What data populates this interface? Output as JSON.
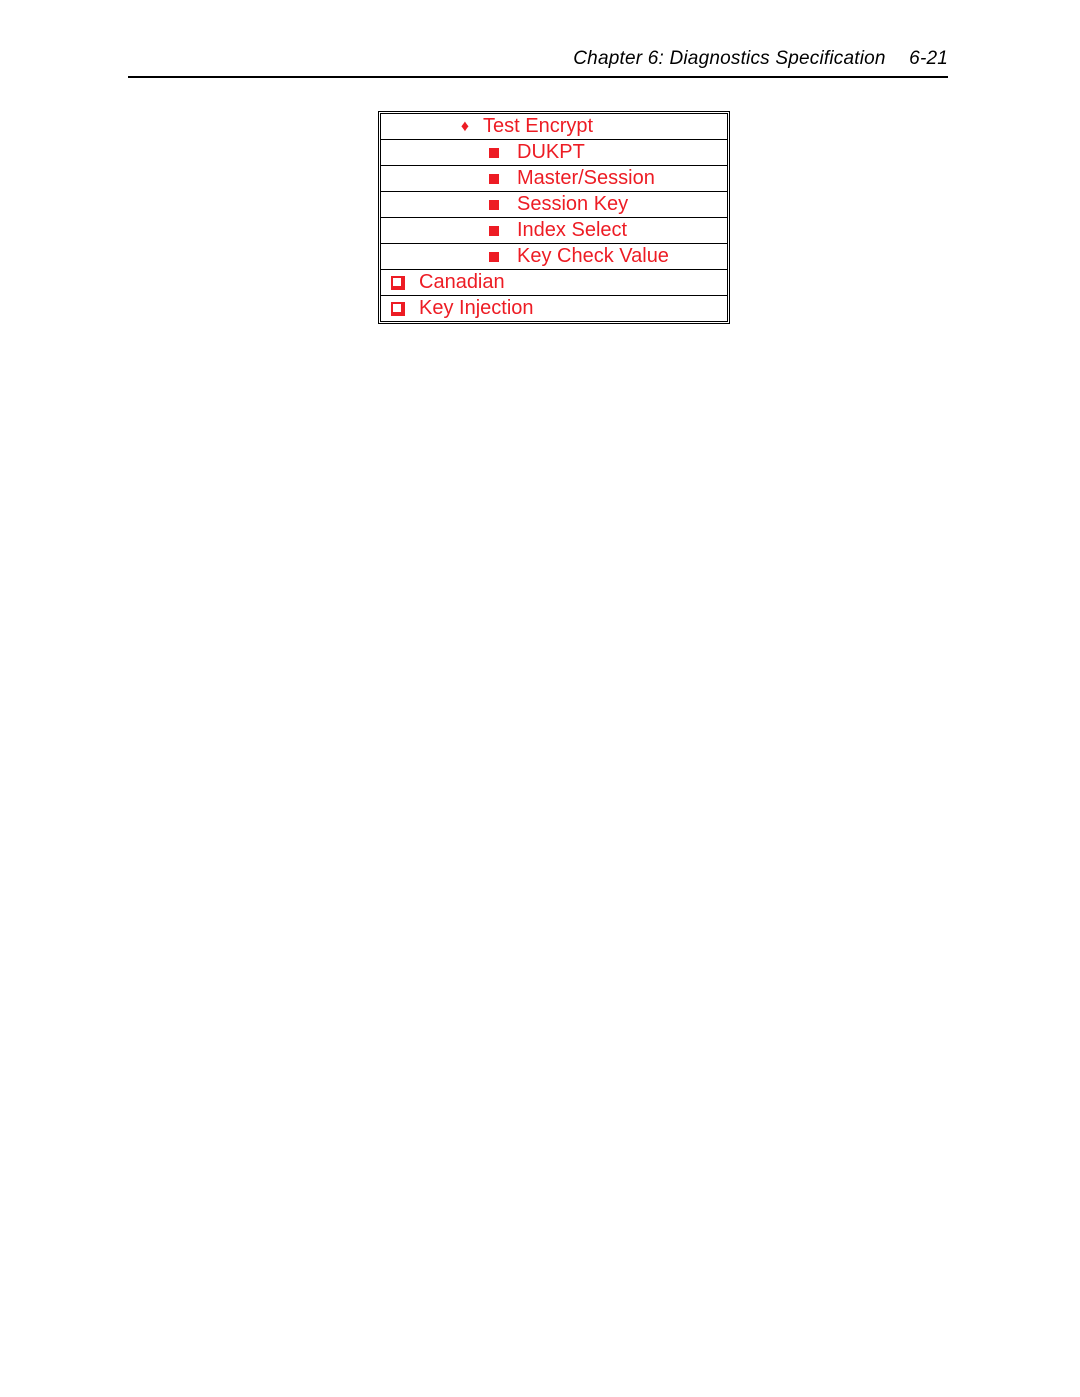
{
  "header": {
    "title": "Chapter 6: Diagnostics Specification",
    "page_num": "6-21"
  },
  "rows": [
    {
      "bullet": "diamond",
      "label": "Test Encrypt"
    },
    {
      "bullet": "square",
      "label": "DUKPT"
    },
    {
      "bullet": "square",
      "label": "Master/Session"
    },
    {
      "bullet": "square",
      "label": "Session Key"
    },
    {
      "bullet": "square",
      "label": "Index Select"
    },
    {
      "bullet": "square",
      "label": "Key Check Value"
    },
    {
      "bullet": "box",
      "label": "Canadian"
    },
    {
      "bullet": "box",
      "label": "Key Injection"
    }
  ]
}
